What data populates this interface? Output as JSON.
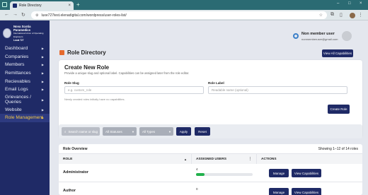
{
  "browser": {
    "tab_title": "Role Directory",
    "url": "luxe727test.elenadigital.com/wordpress/user-roles-list/"
  },
  "sidebar": {
    "logo_line1": "Nova Scotia Paramedics",
    "logo_line2": "International Union of Operating Engineers",
    "logo_line3": "Local 727",
    "items": [
      {
        "label": "Dashboard"
      },
      {
        "label": "Companies"
      },
      {
        "label": "Members"
      },
      {
        "label": "Remittances"
      },
      {
        "label": "Recievables"
      },
      {
        "label": "Email Logs"
      },
      {
        "label": "Grievances / Queries"
      },
      {
        "label": "Website"
      },
      {
        "label": "Role Management"
      }
    ]
  },
  "user": {
    "name": "Non member user",
    "email": "nonmemberuser@gmail.com"
  },
  "page": {
    "title": "Role Directory",
    "view_all_label": "View All Capabilities"
  },
  "create_role": {
    "heading": "Create New Role",
    "subtitle": "Provide a unique slug and optional label. Capabilities can be assigned later from the role editor.",
    "slug_label": "Role Slug",
    "slug_placeholder": "e.g. custom_role",
    "label_label": "Role Label",
    "label_placeholder": "Readable name (optional)",
    "hint": "Newly created roles initially have no capabilities.",
    "create_button": "Create Role"
  },
  "filters": {
    "search_placeholder": "Search name or slug",
    "statuses_value": "All Statuses",
    "types_value": "All Types",
    "apply_label": "Apply",
    "reset_label": "Reset"
  },
  "table": {
    "title": "Role Overview",
    "showing": "Showing 1–12 of 14 roles",
    "columns": [
      "ROLE",
      "ASSIGNED USERS",
      "ACTIONS"
    ],
    "sort_role_glyph": "▲",
    "sort_users_glyph": "⋮",
    "rows": [
      {
        "role": "Administrator",
        "count": "4",
        "progress": 0.15,
        "manage": "Manage",
        "view": "View Capabilities"
      },
      {
        "role": "Author",
        "count": "0",
        "progress": 0,
        "manage": "Manage",
        "view": "View Capabilities"
      }
    ]
  },
  "colors": {
    "sidebar_bg": "#1f2a66",
    "accent_active": "#f3c845",
    "primary_button": "#1f2a66",
    "progress_green": "#22b14c"
  }
}
